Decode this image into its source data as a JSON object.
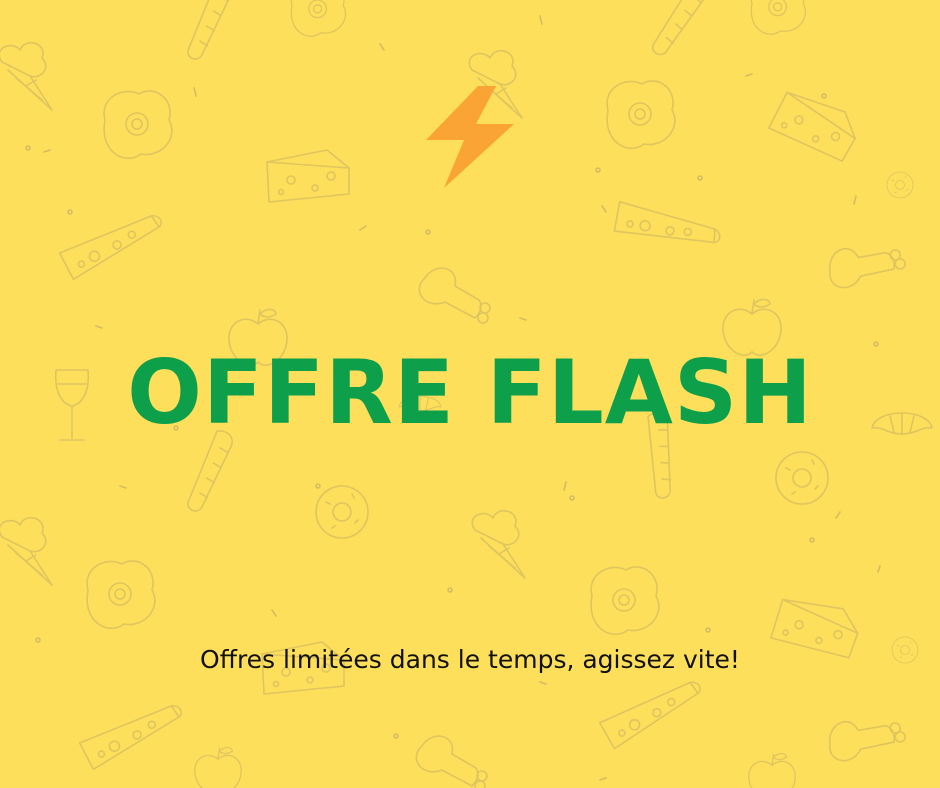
{
  "banner": {
    "headline": "OFFRE FLASH",
    "subtitle": "Offres limitées dans le temps, agissez vite!"
  },
  "colors": {
    "background": "#FDDF5C",
    "headline": "#0E9F4B",
    "bolt": "#F9A435",
    "doodle": "#C9B062",
    "subtitle": "#111111"
  },
  "icons": {
    "accent": "lightning-bolt-icon",
    "background_pattern": [
      "egg-icon",
      "cheese-icon",
      "pizza-slice-icon",
      "ice-cream-cone-icon",
      "chicken-leg-icon",
      "apple-icon",
      "donut-icon",
      "wine-glass-icon",
      "croissant-icon",
      "bread-icon"
    ]
  }
}
